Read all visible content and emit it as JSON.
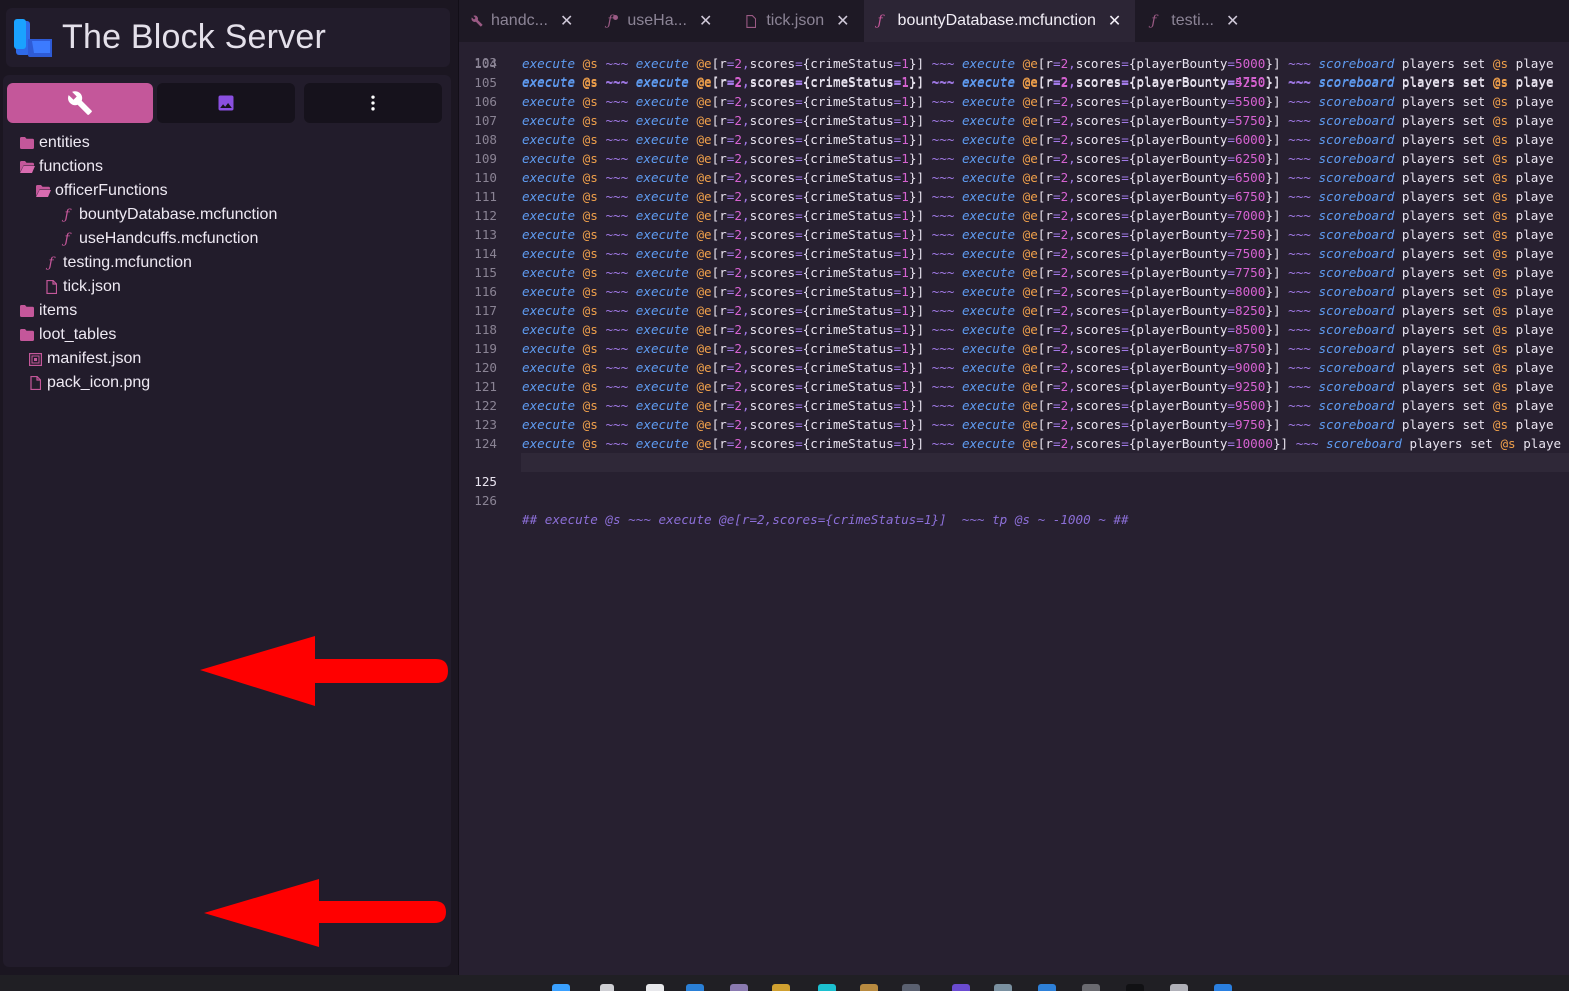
{
  "app": {
    "title": "The Block Server",
    "accent": "#c4579a"
  },
  "toolbar": {
    "buttons": [
      {
        "name": "tools",
        "icon": "wrench-icon",
        "active": true
      },
      {
        "name": "image",
        "icon": "image-icon",
        "active": false
      },
      {
        "name": "more",
        "icon": "more-vertical-icon",
        "active": false
      }
    ]
  },
  "file_tree": [
    {
      "label": "entities",
      "type": "folder",
      "depth": 0,
      "open": false
    },
    {
      "label": "functions",
      "type": "folder",
      "depth": 0,
      "open": true
    },
    {
      "label": "officerFunctions",
      "type": "folder",
      "depth": 1,
      "open": true
    },
    {
      "label": "bountyDatabase.mcfunction",
      "type": "function",
      "depth": 2
    },
    {
      "label": "useHandcuffs.mcfunction",
      "type": "function",
      "depth": 2
    },
    {
      "label": "testing.mcfunction",
      "type": "function",
      "depth": 1
    },
    {
      "label": "tick.json",
      "type": "file",
      "depth": 1
    },
    {
      "label": "items",
      "type": "folder",
      "depth": 0,
      "open": false
    },
    {
      "label": "loot_tables",
      "type": "folder",
      "depth": 0,
      "open": false
    },
    {
      "label": "manifest.json",
      "type": "manifest",
      "depth": 0
    },
    {
      "label": "pack_icon.png",
      "type": "file",
      "depth": 0
    }
  ],
  "tabs": [
    {
      "label": "handc...",
      "icon": "wrench-icon",
      "active": false
    },
    {
      "label": "useHa...",
      "icon": "function-modified-icon",
      "active": false
    },
    {
      "label": "tick.json",
      "icon": "file-icon",
      "active": false
    },
    {
      "label": "bountyDatabase.mcfunction",
      "icon": "function-icon",
      "active": true
    },
    {
      "label": "testi...",
      "icon": "function-icon",
      "active": false
    }
  ],
  "editor": {
    "lines": [
      {
        "n": 104,
        "bounty": "5000"
      },
      {
        "n": 105,
        "bounty": "5250"
      },
      {
        "n": 106,
        "bounty": "5500"
      },
      {
        "n": 107,
        "bounty": "5750"
      },
      {
        "n": 108,
        "bounty": "6000"
      },
      {
        "n": 109,
        "bounty": "6250"
      },
      {
        "n": 110,
        "bounty": "6500"
      },
      {
        "n": 111,
        "bounty": "6750"
      },
      {
        "n": 112,
        "bounty": "7000"
      },
      {
        "n": 113,
        "bounty": "7250"
      },
      {
        "n": 114,
        "bounty": "7500"
      },
      {
        "n": 115,
        "bounty": "7750"
      },
      {
        "n": 116,
        "bounty": "8000"
      },
      {
        "n": 117,
        "bounty": "8250"
      },
      {
        "n": 118,
        "bounty": "8500"
      },
      {
        "n": 119,
        "bounty": "8750"
      },
      {
        "n": 120,
        "bounty": "9000"
      },
      {
        "n": 121,
        "bounty": "9250"
      },
      {
        "n": 122,
        "bounty": "9500"
      },
      {
        "n": 123,
        "bounty": "9750"
      },
      {
        "n": 124,
        "bounty": "10000"
      }
    ],
    "current_line": 125,
    "last_line": 126,
    "comment": "## execute @s ~~~ execute @e[r=2,scores={crimeStatus=1}]  ~~~ tp @s ~ -1000 ~ ##",
    "colors": {
      "keyword": "#5f9cf2",
      "selector": "#f0a04b",
      "number": "#d662d1",
      "comment": "#8c6fd8"
    }
  },
  "annotations": {
    "arrow_color": "#ff0000"
  }
}
